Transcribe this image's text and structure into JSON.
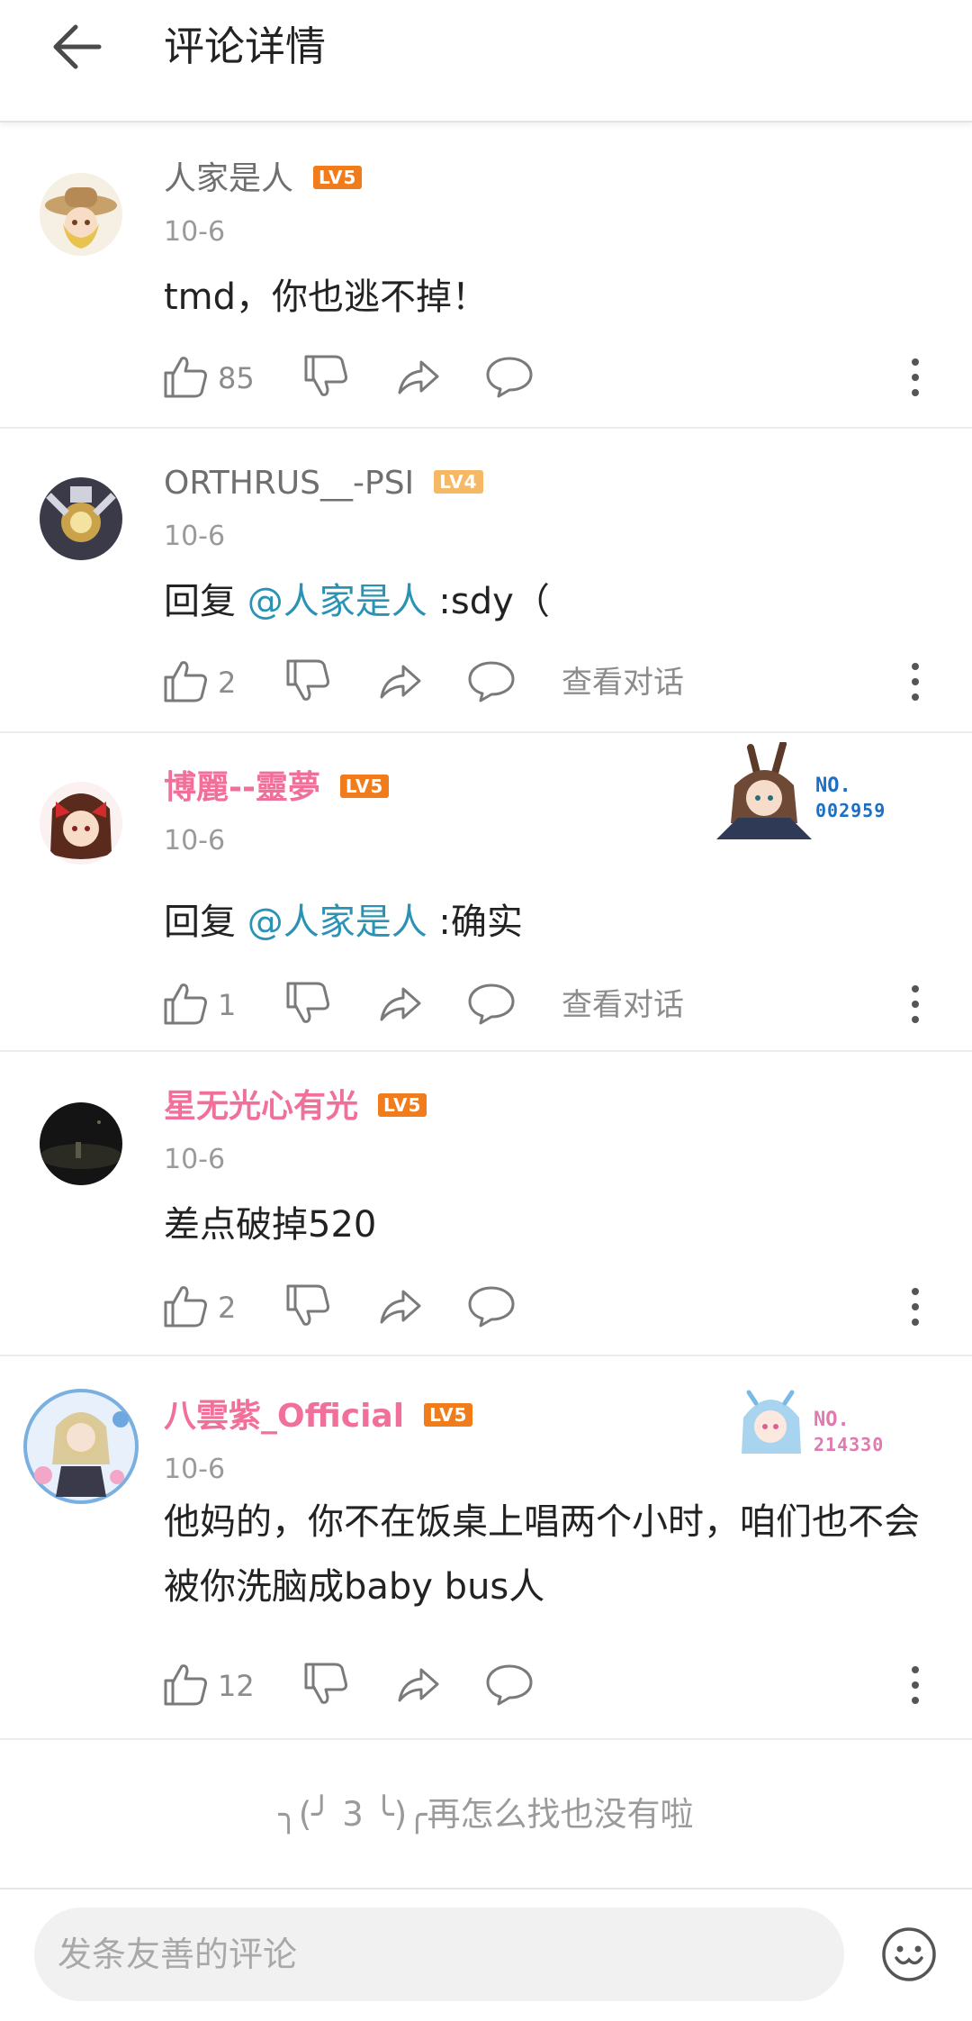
{
  "header": {
    "title": "评论详情"
  },
  "comments": [
    {
      "username": "人家是人",
      "level": "LV5",
      "date": "10-6",
      "content": "tmd，你也逃不掉！",
      "likes": "85",
      "view_dialog": ""
    },
    {
      "username": "ORTHRUS__-PSI",
      "level": "LV4",
      "date": "10-6",
      "reply_prefix": "回复 ",
      "mention": "@人家是人",
      "content": " :sdy（",
      "likes": "2",
      "view_dialog": "查看对话"
    },
    {
      "username": "博麗--靈夢",
      "level": "LV5",
      "date": "10-6",
      "reply_prefix": "回复 ",
      "mention": "@人家是人",
      "content": " :确实",
      "likes": "1",
      "view_dialog": "查看对话",
      "badge_no": "NO.",
      "badge_number": "002959"
    },
    {
      "username": "星无光心有光",
      "level": "LV5",
      "date": "10-6",
      "content": "差点破掉520",
      "likes": "2",
      "view_dialog": ""
    },
    {
      "username": "八雲紫_Official",
      "level": "LV5",
      "date": "10-6",
      "content": "他妈的，你不在饭桌上唱两个小时，咱们也不会被你洗脑成baby bus人",
      "likes": "12",
      "view_dialog": "",
      "badge_no": "NO.",
      "badge_number": "214330"
    }
  ],
  "end_message": "╮(╯ 3 ╰)╭再怎么找也没有啦",
  "input": {
    "placeholder": "发条友善的评论"
  },
  "colors": {
    "accent_pink": "#f0709a",
    "mention_blue": "#2a93b5",
    "level_orange": "#f07c1b"
  }
}
